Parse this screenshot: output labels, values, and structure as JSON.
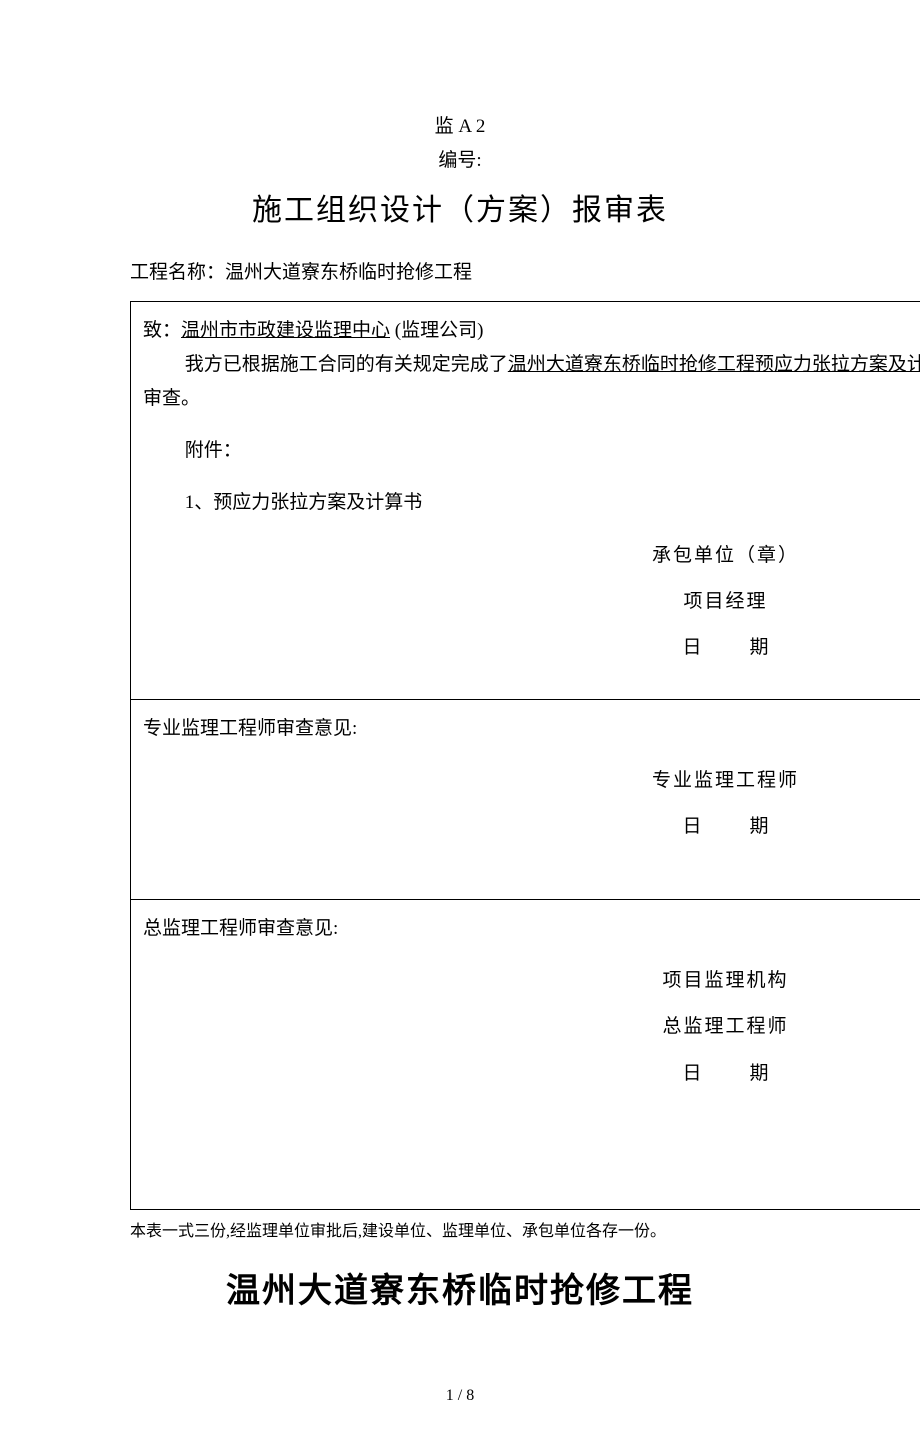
{
  "header": {
    "code": "监 A 2",
    "serial_label": "编号:",
    "title": "施工组织设计（方案）报审表"
  },
  "project": {
    "label": "工程名称：",
    "name": "温州大道寮东桥临时抢修工程"
  },
  "cell1": {
    "to_prefix": "致：",
    "to_company": "温州市市政建设监理中心",
    "to_suffix": "   (监理公司)",
    "body_prefix": "我方已根据施工合同的有关规定完成了",
    "body_underlined": "温州大道寮东桥临时抢修工程预应力张拉方案及计算",
    "review_line": "审查。",
    "attach_label": "附件：",
    "attach_item": "1、预应力张拉方案及计算书",
    "sig1": "承包单位（章）",
    "sig2": "项目经理",
    "sig3_a": "日",
    "sig3_b": "期"
  },
  "cell2": {
    "heading": "专业监理工程师审查意见:",
    "sig1": "专业监理工程师",
    "sig2_a": "日",
    "sig2_b": "期"
  },
  "cell3": {
    "heading": "总监理工程师审查意见:",
    "sig1": "项目监理机构",
    "sig2": "总监理工程师",
    "sig3_a": "日",
    "sig3_b": "期"
  },
  "footer_note": "本表一式三份,经监理单位审批后,建设单位、监理单位、承包单位各存一份。",
  "big_title": "温州大道寮东桥临时抢修工程",
  "page_num": "1 / 8"
}
